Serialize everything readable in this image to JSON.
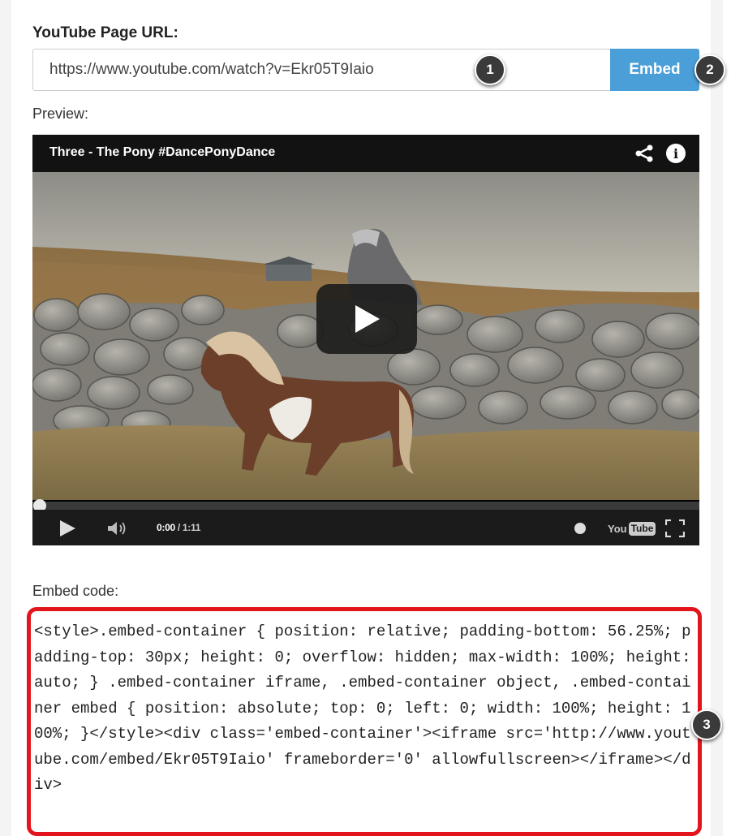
{
  "form": {
    "url_label": "YouTube Page URL:",
    "url_value": "https://www.youtube.com/watch?v=Ekr05T9Iaio",
    "embed_button": "Embed",
    "preview_label": "Preview:",
    "embed_code_label": "Embed code:",
    "embed_code": "<style>.embed-container { position: relative; padding-bottom: 56.25%; padding-top: 30px; height: 0; overflow: hidden; max-width: 100%; height: auto; } .embed-container iframe, .embed-container object, .embed-container embed { position: absolute; top: 0; left: 0; width: 100%; height: 100%; }</style><div class='embed-container'><iframe src='http://www.youtube.com/embed/Ekr05T9Iaio' frameborder='0' allowfullscreen></iframe></div>"
  },
  "markers": [
    "1",
    "2",
    "3"
  ],
  "video": {
    "title": "Three - The Pony #DancePonyDance",
    "time_current": "0:00",
    "time_total": " / 1:11",
    "progress": 0,
    "youtube_logo_you": "You",
    "youtube_logo_tube": "Tube",
    "info_glyph": "i"
  },
  "colors": {
    "embed_button": "#4a9fd8",
    "highlight_border": "#e3141b",
    "marker": "#3a3a3a"
  },
  "icons": [
    "share-icon",
    "info-icon",
    "play-icon",
    "volume-icon",
    "clock-icon",
    "fullscreen-icon"
  ]
}
